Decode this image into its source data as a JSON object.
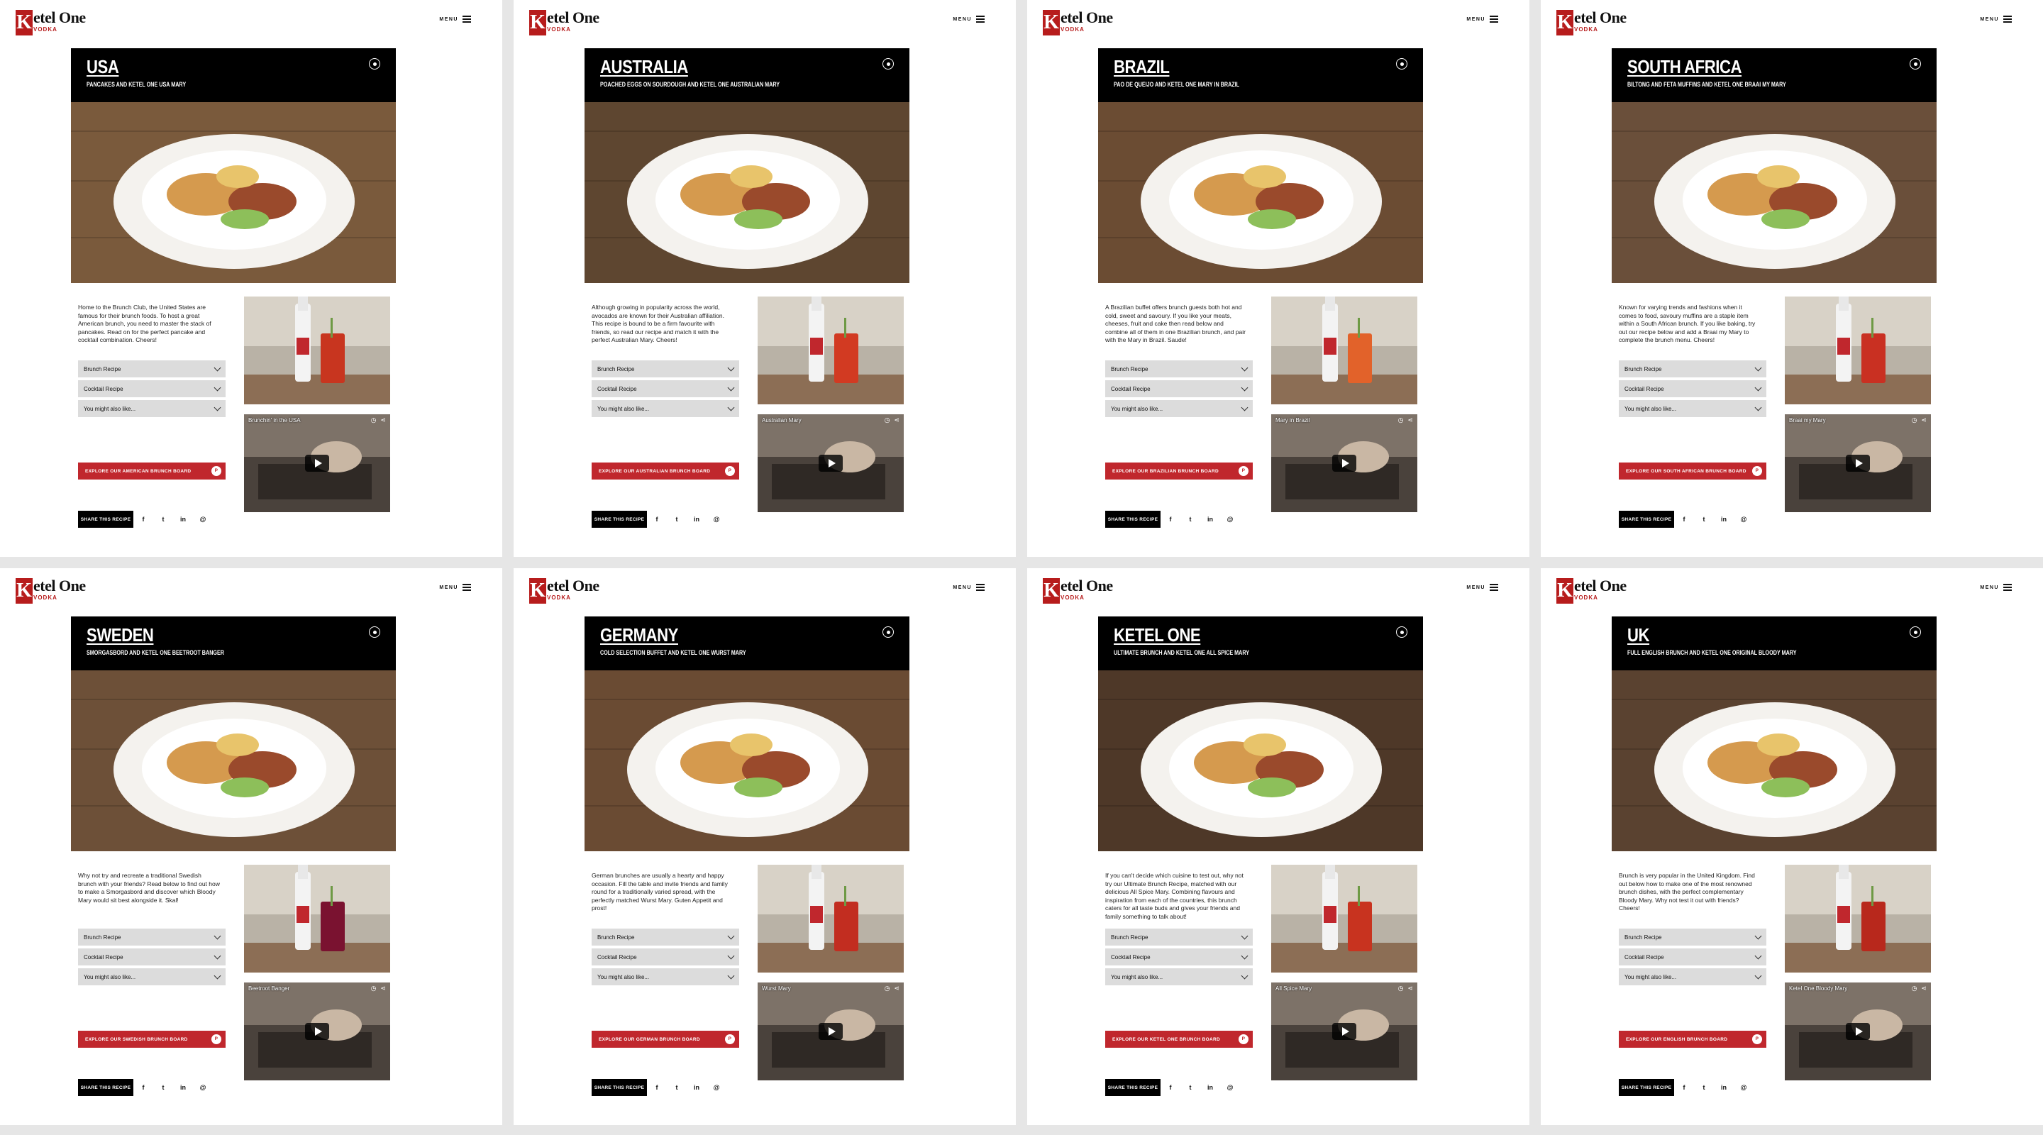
{
  "brand": {
    "mark": "K",
    "word": "etel One",
    "sub": "VODKA"
  },
  "menu_label": "MENU",
  "labels": {
    "brunch": "Brunch Recipe",
    "cocktail": "Cocktail Recipe",
    "more": "You might also like...",
    "share": "SHARE THIS RECIPE",
    "social": [
      "f",
      "t",
      "in",
      "@"
    ]
  },
  "colors": {
    "accent": "#c0272d",
    "header": "#000000",
    "accordion": "#dcdcdc"
  },
  "panels": [
    {
      "country": "USA",
      "subtitle": "PANCAKES AND KETEL ONE USA MARY",
      "description": "Home to the Brunch Club, the United States are famous for their brunch foods. To host a great American brunch, you need to master the stack of pancakes. Read on for the perfect pancake and cocktail combination. Cheers!",
      "explore": "EXPLORE OUR AMERICAN BRUNCH BOARD",
      "video_title": "Brunchin' in the USA",
      "drink_color": "#c8351f",
      "table_color": "#7a5a3c"
    },
    {
      "country": "AUSTRALIA",
      "subtitle": "POACHED EGGS ON SOURDOUGH AND KETEL ONE AUSTRALIAN MARY",
      "description": "Although growing in popularity across the world, avocados are known for their Australian affiliation. This recipe is bound to be a firm favourite with friends, so read our recipe and match it with the perfect Australian Mary. Cheers!",
      "explore": "EXPLORE OUR AUSTRALIAN BRUNCH BOARD",
      "video_title": "Australian Mary",
      "drink_color": "#d23a22",
      "table_color": "#5e4630"
    },
    {
      "country": "BRAZIL",
      "subtitle": "PAO DE QUEIJO AND KETEL ONE MARY IN BRAZIL",
      "description": "A Brazilian buffet offers brunch guests both hot and cold, sweet and savoury. If you like your meats, cheeses, fruit and cake then read below and combine all of them in one Brazilian brunch, and pair with the Mary in Brazil. Saude!",
      "explore": "EXPLORE OUR BRAZILIAN BRUNCH BOARD",
      "video_title": "Mary in Brazil",
      "drink_color": "#e2622a",
      "table_color": "#6b4c33"
    },
    {
      "country": "SOUTH AFRICA",
      "subtitle": "BILTONG AND FETA MUFFINS AND KETEL ONE BRAAI MY MARY",
      "description": "Known for varying trends and fashions when it comes to food, savoury muffins are a staple item within a South African brunch. If you like baking, try out our recipe below and add a Braai my Mary to complete the brunch menu. Cheers!",
      "explore": "EXPLORE OUR SOUTH AFRICAN BRUNCH BOARD",
      "video_title": "Braai my Mary",
      "drink_color": "#c93022",
      "table_color": "#6a4f3a"
    },
    {
      "country": "SWEDEN",
      "subtitle": "SMORGASBORD AND KETEL ONE BEETROOT BANGER",
      "description": "Why not try and recreate a traditional Swedish brunch with your friends? Read below to find out how to make a Smorgasbord and discover which Bloody Mary would sit best alongside it. Skal!",
      "explore": "EXPLORE OUR SWEDISH BRUNCH BOARD",
      "video_title": "Beetroot Banger",
      "drink_color": "#7a1230",
      "table_color": "#6d5038"
    },
    {
      "country": "GERMANY",
      "subtitle": "COLD SELECTION BUFFET AND KETEL ONE WURST MARY",
      "description": "German brunches are usually a hearty and happy occasion. Fill the table and invite friends and family round for a traditionally varied spread, with the perfectly matched Wurst Mary. Guten Appetit and prost!",
      "explore": "EXPLORE OUR GERMAN BRUNCH BOARD",
      "video_title": "Wurst Mary",
      "drink_color": "#c22d20",
      "table_color": "#6a4b33"
    },
    {
      "country": "KETEL ONE",
      "subtitle": "ULTIMATE BRUNCH AND KETEL ONE ALL SPICE MARY",
      "description": "If you can't decide which cuisine to test out, why not try our Ultimate Brunch Recipe, matched with our delicious All Spice Mary. Combining flavours and inspiration from each of the countries, this brunch caters for all taste buds and gives your friends and family something to talk about!",
      "explore": "EXPLORE OUR KETEL ONE BRUNCH BOARD",
      "video_title": "All Spice Mary",
      "drink_color": "#c8331f",
      "table_color": "#4e3828"
    },
    {
      "country": "UK",
      "subtitle": "FULL ENGLISH BRUNCH AND KETEL ONE ORIGINAL BLOODY MARY",
      "description": "Brunch is very popular in the United Kingdom. Find out below how to make one of the most renowned brunch dishes, with the perfect complementary Bloody Mary. Why not test it out with friends? Cheers!",
      "explore": "EXPLORE OUR ENGLISH BRUNCH BOARD",
      "video_title": "Ketel One Bloody Mary",
      "drink_color": "#b8281c",
      "table_color": "#5a4230"
    }
  ]
}
